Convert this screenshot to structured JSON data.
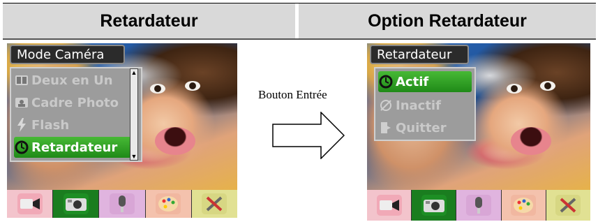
{
  "header": {
    "left_title": "Retardateur",
    "right_title": "Option Retardateur"
  },
  "left_screen": {
    "menu_title": "Mode Caméra",
    "items": [
      {
        "label": "Deux en Un",
        "icon": "two-in-one-icon"
      },
      {
        "label": "Cadre Photo",
        "icon": "photo-frame-icon"
      },
      {
        "label": "Flash",
        "icon": "flash-icon"
      },
      {
        "label": "Retardateur",
        "icon": "self-timer-icon",
        "selected": true
      }
    ]
  },
  "right_screen": {
    "menu_title": "Retardateur",
    "items": [
      {
        "label": "Actif",
        "icon": "self-timer-icon",
        "selected": true
      },
      {
        "label": "Inactif",
        "icon": "timer-off-icon"
      },
      {
        "label": "Quitter",
        "icon": "exit-icon"
      }
    ]
  },
  "annotation": {
    "label": "Bouton Entrée"
  },
  "tabs": [
    {
      "name": "video-mode-tab",
      "icon": "camcorder-icon",
      "color": "#f1a9b7"
    },
    {
      "name": "camera-mode-tab",
      "icon": "camera-icon",
      "color": "#1d8e24",
      "active": true
    },
    {
      "name": "voice-mode-tab",
      "icon": "microphone-icon",
      "color": "#d8a6d6"
    },
    {
      "name": "effects-tab",
      "icon": "palette-icon",
      "color": "#f1b7a0"
    },
    {
      "name": "setup-tab",
      "icon": "tools-icon",
      "color": "#d7d783"
    }
  ],
  "colors": {
    "header_bg": "#d9d9d9",
    "selected_item": "#2f9f25",
    "menu_bg": "#9c9c9c"
  }
}
